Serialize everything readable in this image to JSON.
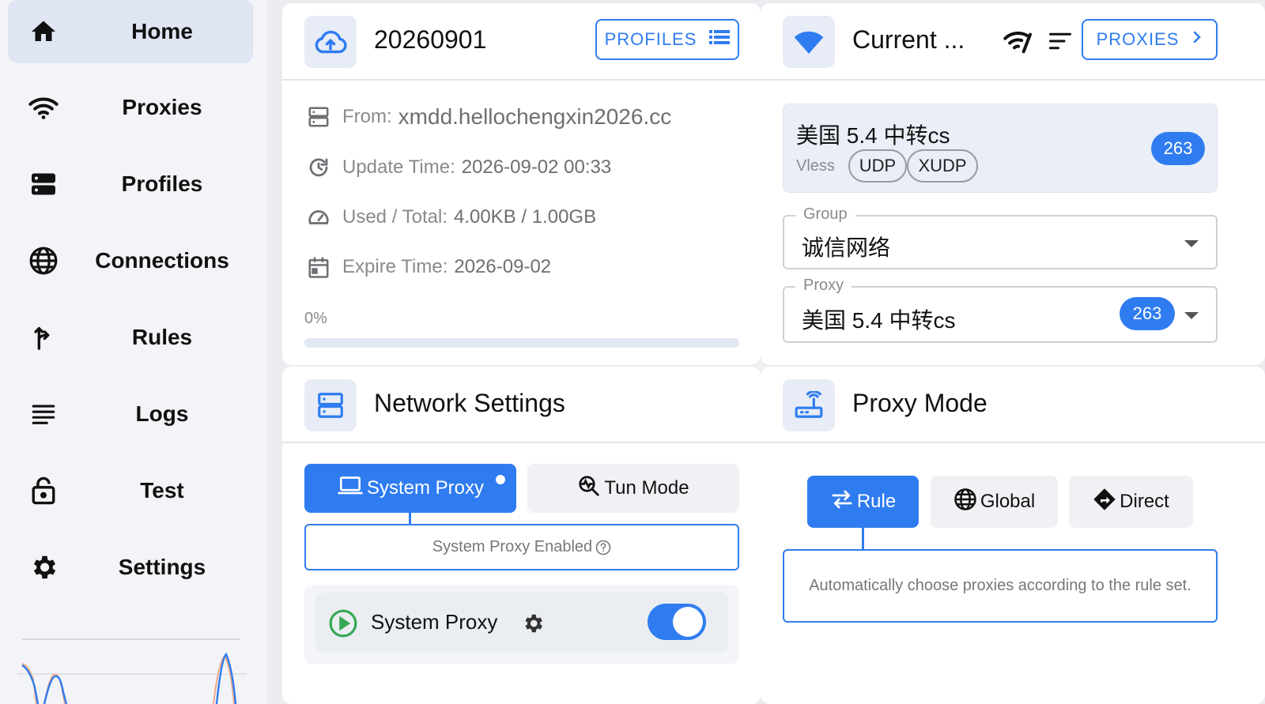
{
  "sidebar": {
    "items": [
      {
        "label": "Home",
        "icon": "home-icon",
        "active": true
      },
      {
        "label": "Proxies",
        "icon": "wifi-icon"
      },
      {
        "label": "Profiles",
        "icon": "storage-icon"
      },
      {
        "label": "Connections",
        "icon": "globe-icon"
      },
      {
        "label": "Rules",
        "icon": "fork-arrow-icon"
      },
      {
        "label": "Logs",
        "icon": "lines-icon"
      },
      {
        "label": "Test",
        "icon": "lock-icon"
      },
      {
        "label": "Settings",
        "icon": "gear-icon"
      }
    ]
  },
  "profile": {
    "title": "20260901",
    "button": "PROFILES",
    "from_label": "From:",
    "from_value": "xmdd.hellochengxin2026.cc",
    "update_label": "Update Time:",
    "update_value": "2026-09-02 00:33",
    "used_label": "Used / Total:",
    "used_value": "4.00KB / 1.00GB",
    "expire_label": "Expire Time:",
    "expire_value": "2026-09-02",
    "progress_text": "0%",
    "progress_percent": 0
  },
  "current": {
    "title": "Current ...",
    "button": "PROXIES",
    "proxy_name": "美国 5.4 中转cs",
    "proxy_type": "Vless",
    "tags": [
      "UDP",
      "XUDP"
    ],
    "delay": "263",
    "group_legend": "Group",
    "group_value": "诚信网络",
    "proxy_legend": "Proxy",
    "proxy_value": "美国 5.4 中转cs",
    "proxy_delay": "263"
  },
  "network": {
    "title": "Network Settings",
    "system_proxy_btn": "System Proxy",
    "tun_mode_btn": "Tun Mode",
    "status_text": "System Proxy Enabled",
    "row_label": "System Proxy",
    "toggle_on": true
  },
  "mode": {
    "title": "Proxy Mode",
    "rule": "Rule",
    "global": "Global",
    "direct": "Direct",
    "description": "Automatically choose proxies according to the rule set."
  },
  "colors": {
    "accent": "#2f7cf0",
    "sidebar_active": "#dfe5f2",
    "card_bg": "#ffffff",
    "page_bg": "#ececf0"
  }
}
